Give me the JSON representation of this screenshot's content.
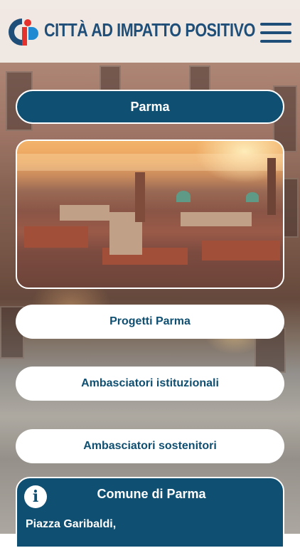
{
  "header": {
    "title": "CITTÀ AD IMPATTO POSITIVO",
    "logo_icon": "ci-logo-icon",
    "menu_icon": "hamburger-menu-icon"
  },
  "city_button": {
    "label": "Parma"
  },
  "links": [
    {
      "label": "Progetti Parma"
    },
    {
      "label": "Ambasciatori istituzionali"
    },
    {
      "label": "Ambasciatori sostenitori"
    }
  ],
  "info_card": {
    "icon": "info-icon",
    "title": "Comune di Parma",
    "address": "Piazza Garibaldi,"
  },
  "colors": {
    "brand": "#1f4f79",
    "accent_blue": "#0e4f72",
    "logo_red": "#e5322d",
    "logo_blue": "#1f8ad1"
  }
}
